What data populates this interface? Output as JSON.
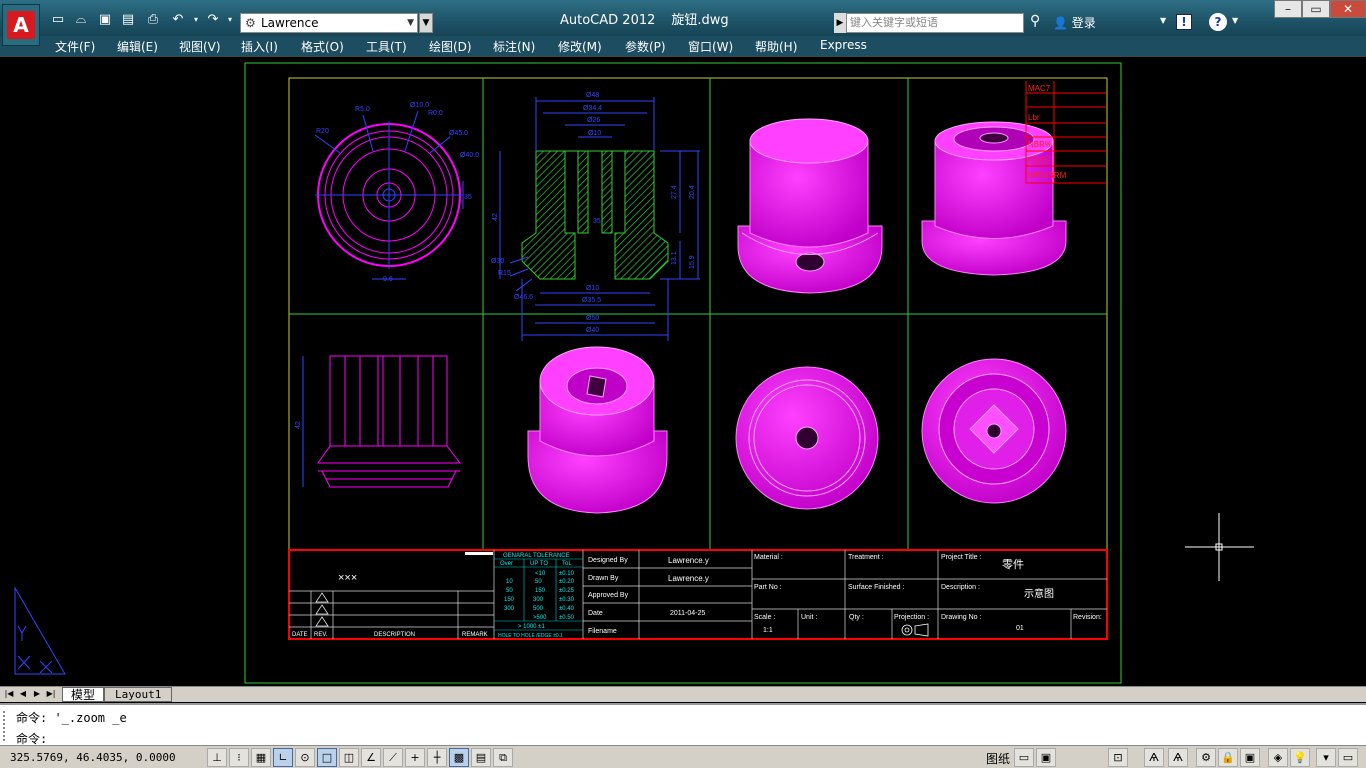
{
  "app": {
    "title": "AutoCAD 2012",
    "filename": "旋钮.dwg",
    "workspace": "Lawrence",
    "search_placeholder": "键入关键字或短语",
    "login": "登录",
    "logo_letter": "A"
  },
  "menus": [
    "文件(F)",
    "编辑(E)",
    "视图(V)",
    "插入(I)",
    "格式(O)",
    "工具(T)",
    "绘图(D)",
    "标注(N)",
    "修改(M)",
    "参数(P)",
    "窗口(W)",
    "帮助(H)",
    "Express"
  ],
  "drawing": {
    "company": "×××",
    "dims": {
      "d5": "R5.0",
      "d10": "Ø10.0",
      "r6": "R0.0",
      "r20": "R20",
      "d45": "Ø45.0",
      "d40": "Ø40.0",
      "d35": "35",
      "t48": "Ø48",
      "t344": "Ø34.4",
      "t26": "Ø26",
      "t10": "Ø10",
      "h274": "27.4",
      "h204": "20.4",
      "h42": "42",
      "h131": "13.1",
      "h159": "15.9",
      "h35": "35",
      "b10": "Ø10",
      "b355": "Ø35.5",
      "b50": "Ø50",
      "b40": "Ø40",
      "l30": "Ø30",
      "l15": "R15",
      "l68": "Ø46.6",
      "p6": "9.6",
      "v42": "42"
    },
    "tolerance": {
      "title": "GENARAL TOLERANCE",
      "headers": [
        "Over",
        "UP TO",
        "ToL"
      ],
      "rows": [
        [
          "",
          "<10",
          "±0.10"
        ],
        [
          "10",
          "50",
          "±0.20"
        ],
        [
          "50",
          "150",
          "±0.25"
        ],
        [
          "150",
          "300",
          "±0.30"
        ],
        [
          "300",
          "500",
          "±0.40"
        ],
        [
          "",
          ">500",
          "±0.50"
        ]
      ],
      "angular": "> 1000 ±1",
      "note": "HOLE TO HOLE /EDGE ±0.1"
    },
    "revision_headers": [
      "DATE",
      "REV.",
      "DESCRIPTION",
      "REMARK"
    ],
    "title_block": {
      "designed_by_label": "Designed By",
      "designed_by": "Lawrence.y",
      "drawn_by_label": "Drawn By",
      "drawn_by": "Lawrence.y",
      "approved_by_label": "Approved By",
      "date_label": "Date",
      "date": "2011-04-25",
      "filename_label": "Filename",
      "material_label": "Material :",
      "treatment_label": "Treatment :",
      "project_title_label": "Project Title :",
      "project_title": "零件",
      "part_no_label": "Part No :",
      "surface_label": "Surface Finished :",
      "description_label": "Description :",
      "description": "示意图",
      "scale_label": "Scale :",
      "scale": "1:1",
      "unit_label": "Unit :",
      "qty_label": "Qty :",
      "projection_label": "Projection :",
      "drawing_no_label": "Drawing No :",
      "drawing_no": "01",
      "revision_label": "Revision:"
    },
    "note_labels": [
      "MAC7",
      "Lbr",
      "NBR%",
      "PS/EF",
      "SPE4SRM"
    ]
  },
  "tabs": {
    "model": "模型",
    "layout": "Layout1"
  },
  "command": {
    "history": "命令: '_.zoom _e",
    "prompt": "命令:"
  },
  "status": {
    "coords": "325.5769, 46.4035, 0.0000",
    "paper": "图纸"
  },
  "colors": {
    "magenta": "#ff00ff",
    "blue": "#3344ff",
    "green": "#33cc33",
    "yellow": "#cccc33",
    "red": "#ff0000"
  }
}
